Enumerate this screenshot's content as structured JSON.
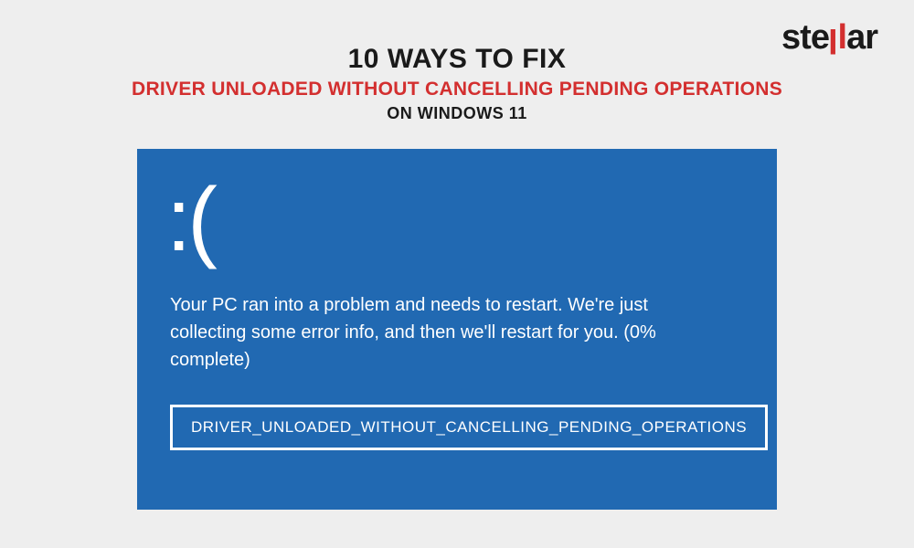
{
  "logo": {
    "text_before": "ste",
    "text_after": "ar",
    "full": "stellar"
  },
  "header": {
    "line1": "10 WAYS TO FIX",
    "line2": "DRIVER UNLOADED WITHOUT CANCELLING PENDING OPERATIONS",
    "line3": "ON WINDOWS 11"
  },
  "bsod": {
    "face": ":(",
    "message": "Your PC ran into a problem and needs to restart. We're just collecting some error info, and then we'll restart for you. (0% complete)",
    "error_code": "DRIVER_UNLOADED_WITHOUT_CANCELLING_PENDING_OPERATIONS"
  }
}
